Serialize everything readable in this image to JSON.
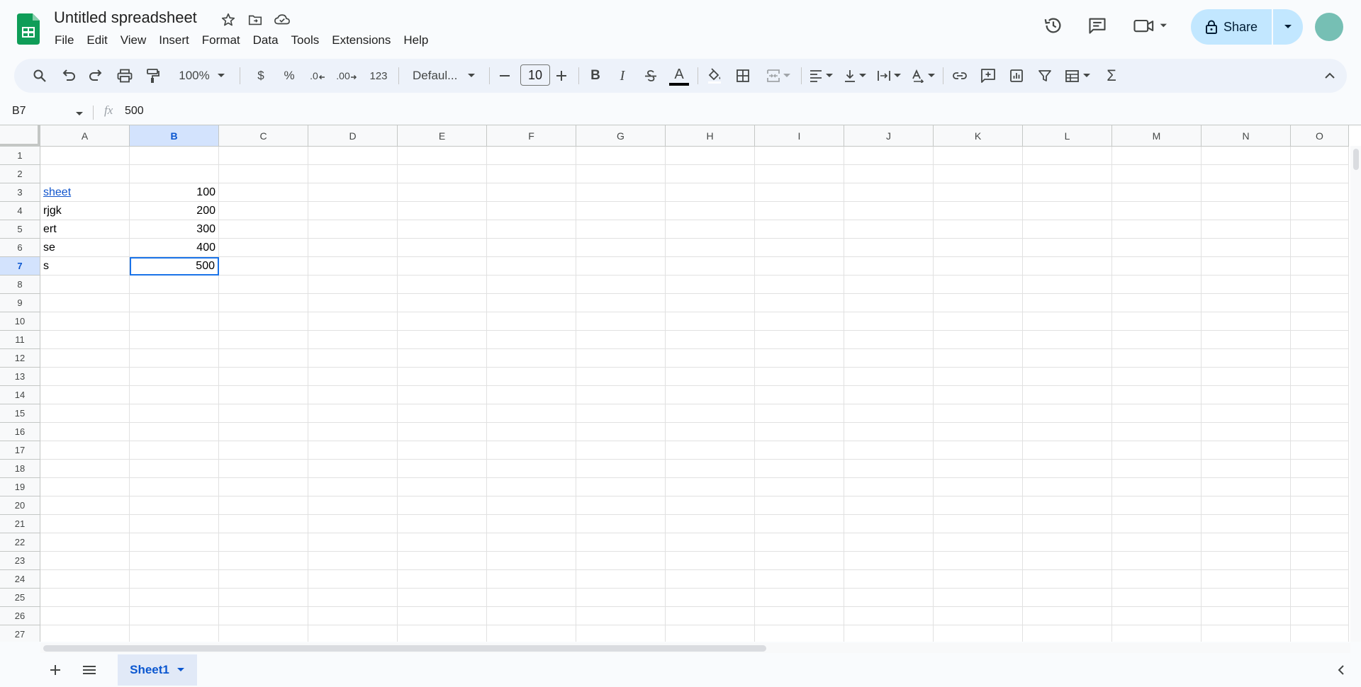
{
  "app": {
    "doc_title": "Untitled spreadsheet",
    "menu": [
      "File",
      "Edit",
      "View",
      "Insert",
      "Format",
      "Data",
      "Tools",
      "Extensions",
      "Help"
    ],
    "share_label": "Share",
    "brand_color": "#0f9d58",
    "accent_color": "#1a73e8"
  },
  "toolbar": {
    "zoom": "100%",
    "currency": "$",
    "percent": "%",
    "dec_decrease": ".0",
    "dec_increase": ".00",
    "number_format": "123",
    "font_name": "Defaul...",
    "font_size": "10",
    "bold": "B",
    "italic": "I",
    "strike": "S",
    "text_color": "A",
    "sum": "Σ"
  },
  "formula_bar": {
    "name_box": "B7",
    "fx": "fx",
    "value": "500"
  },
  "columns": [
    "A",
    "B",
    "C",
    "D",
    "E",
    "F",
    "G",
    "H",
    "I",
    "J",
    "K",
    "L",
    "M",
    "N",
    "O"
  ],
  "rows": [
    "1",
    "2",
    "3",
    "4",
    "5",
    "6",
    "7",
    "8",
    "9",
    "10",
    "11",
    "12",
    "13",
    "14",
    "15",
    "16",
    "17",
    "18",
    "19",
    "20",
    "21",
    "22",
    "23",
    "24",
    "25",
    "26",
    "27"
  ],
  "selected_cell": "B7",
  "cells": [
    {
      "ref": "A3",
      "value": "sheet",
      "link": true
    },
    {
      "ref": "B3",
      "value": "100"
    },
    {
      "ref": "A4",
      "value": "rjgk"
    },
    {
      "ref": "B4",
      "value": "200"
    },
    {
      "ref": "A5",
      "value": "ert"
    },
    {
      "ref": "B5",
      "value": "300"
    },
    {
      "ref": "A6",
      "value": "se"
    },
    {
      "ref": "B6",
      "value": "400"
    },
    {
      "ref": "A7",
      "value": "s"
    },
    {
      "ref": "B7",
      "value": "500"
    }
  ],
  "sheets": [
    {
      "name": "Sheet1",
      "active": true
    }
  ]
}
